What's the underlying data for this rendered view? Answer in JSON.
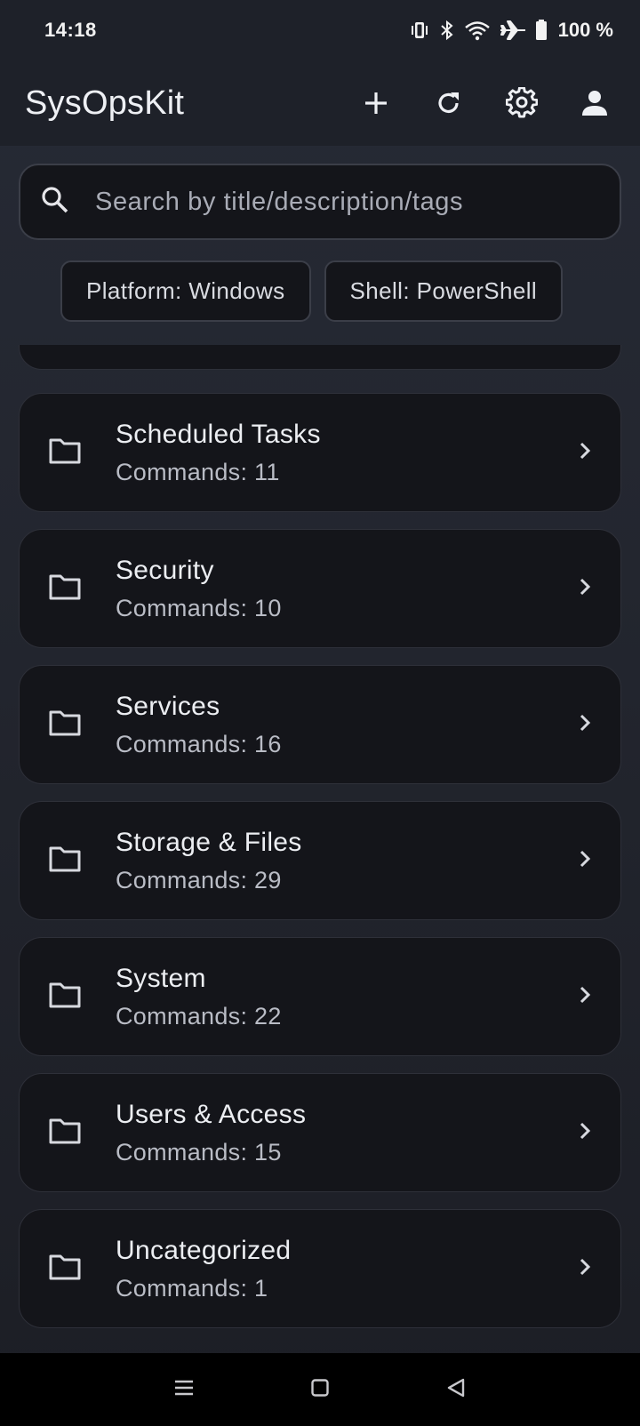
{
  "status": {
    "time": "14:18",
    "battery": "100 %",
    "icons": [
      "vibrate-icon",
      "bluetooth-icon",
      "wifi-icon",
      "airplane-icon",
      "battery-icon"
    ]
  },
  "app": {
    "title": "SysOpsKit",
    "actions": [
      "add-icon",
      "refresh-icon",
      "settings-icon",
      "account-icon"
    ]
  },
  "search": {
    "placeholder": "Search by title/description/tags",
    "value": ""
  },
  "filters": [
    {
      "label": "Platform: Windows"
    },
    {
      "label": "Shell: PowerShell"
    }
  ],
  "categories": [
    {
      "title": "Scheduled Tasks",
      "count": "Commands: 11"
    },
    {
      "title": "Security",
      "count": "Commands: 10"
    },
    {
      "title": "Services",
      "count": "Commands: 16"
    },
    {
      "title": "Storage & Files",
      "count": "Commands: 29"
    },
    {
      "title": "System",
      "count": "Commands: 22"
    },
    {
      "title": "Users & Access",
      "count": "Commands: 15"
    },
    {
      "title": "Uncategorized",
      "count": "Commands: 1"
    }
  ],
  "nav": [
    "menu-icon",
    "home-icon",
    "back-icon"
  ],
  "colors": {
    "background": "#23262f",
    "surface": "#14151a",
    "app_bar": "#1e2129",
    "border": "#3b3e48"
  }
}
